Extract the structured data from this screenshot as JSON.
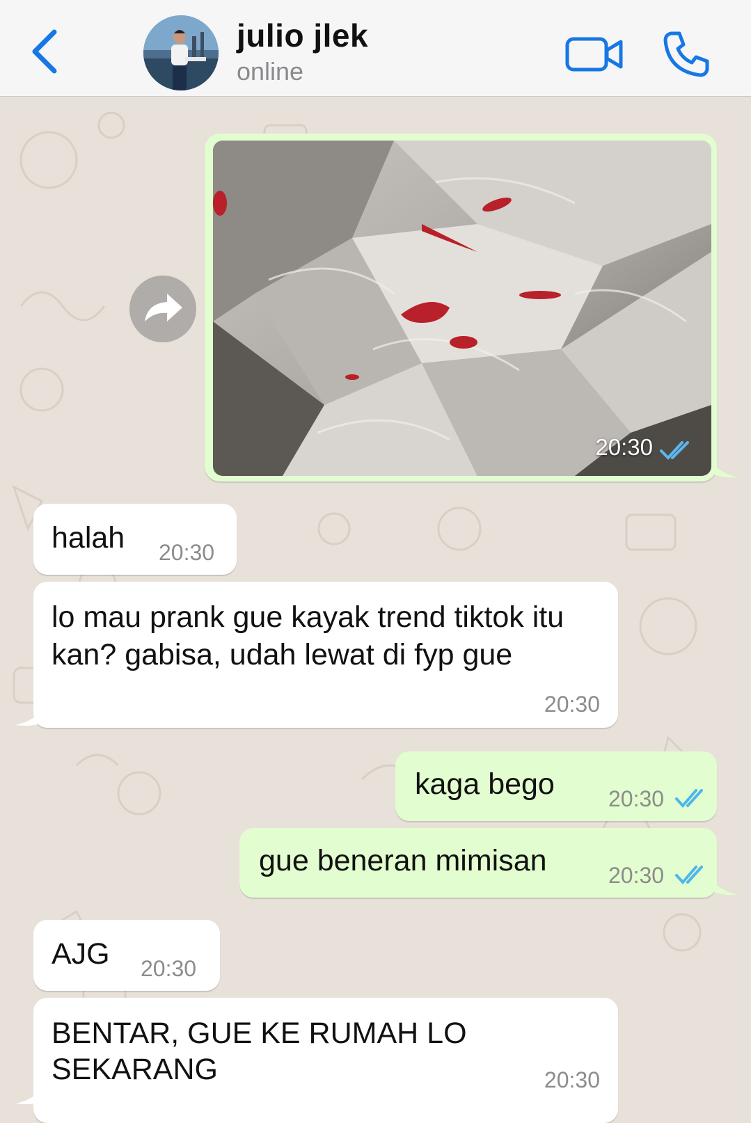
{
  "header": {
    "contact_name": "julio jlek",
    "status": "online"
  },
  "icons": {
    "back": "chevron-left-icon",
    "video": "video-camera-icon",
    "call": "phone-icon",
    "forward": "forward-arrow-icon",
    "read": "double-check-icon"
  },
  "colors": {
    "accent": "#1677e5",
    "incoming_bubble": "#ffffff",
    "outgoing_bubble": "#e2fdcf",
    "read_ticks": "#4fb6ec",
    "wallpaper": "#e8e1d9"
  },
  "messages": [
    {
      "type": "image",
      "direction": "out",
      "time": "20:30",
      "read": true
    },
    {
      "type": "text",
      "direction": "in",
      "text": "halah",
      "time": "20:30"
    },
    {
      "type": "text",
      "direction": "in",
      "text_line1": "lo mau prank gue kayak trend tiktok itu",
      "text_line2": "kan? gabisa, udah lewat di fyp gue",
      "time": "20:30"
    },
    {
      "type": "text",
      "direction": "out",
      "text": "kaga bego",
      "time": "20:30",
      "read": true
    },
    {
      "type": "text",
      "direction": "out",
      "text": "gue beneran mimisan",
      "time": "20:30",
      "read": true
    },
    {
      "type": "text",
      "direction": "in",
      "text": "AJG",
      "time": "20:30"
    },
    {
      "type": "text",
      "direction": "in",
      "text_line1": "BENTAR, GUE KE RUMAH LO",
      "text_line2": "SEKARANG",
      "time": "20:30"
    }
  ]
}
